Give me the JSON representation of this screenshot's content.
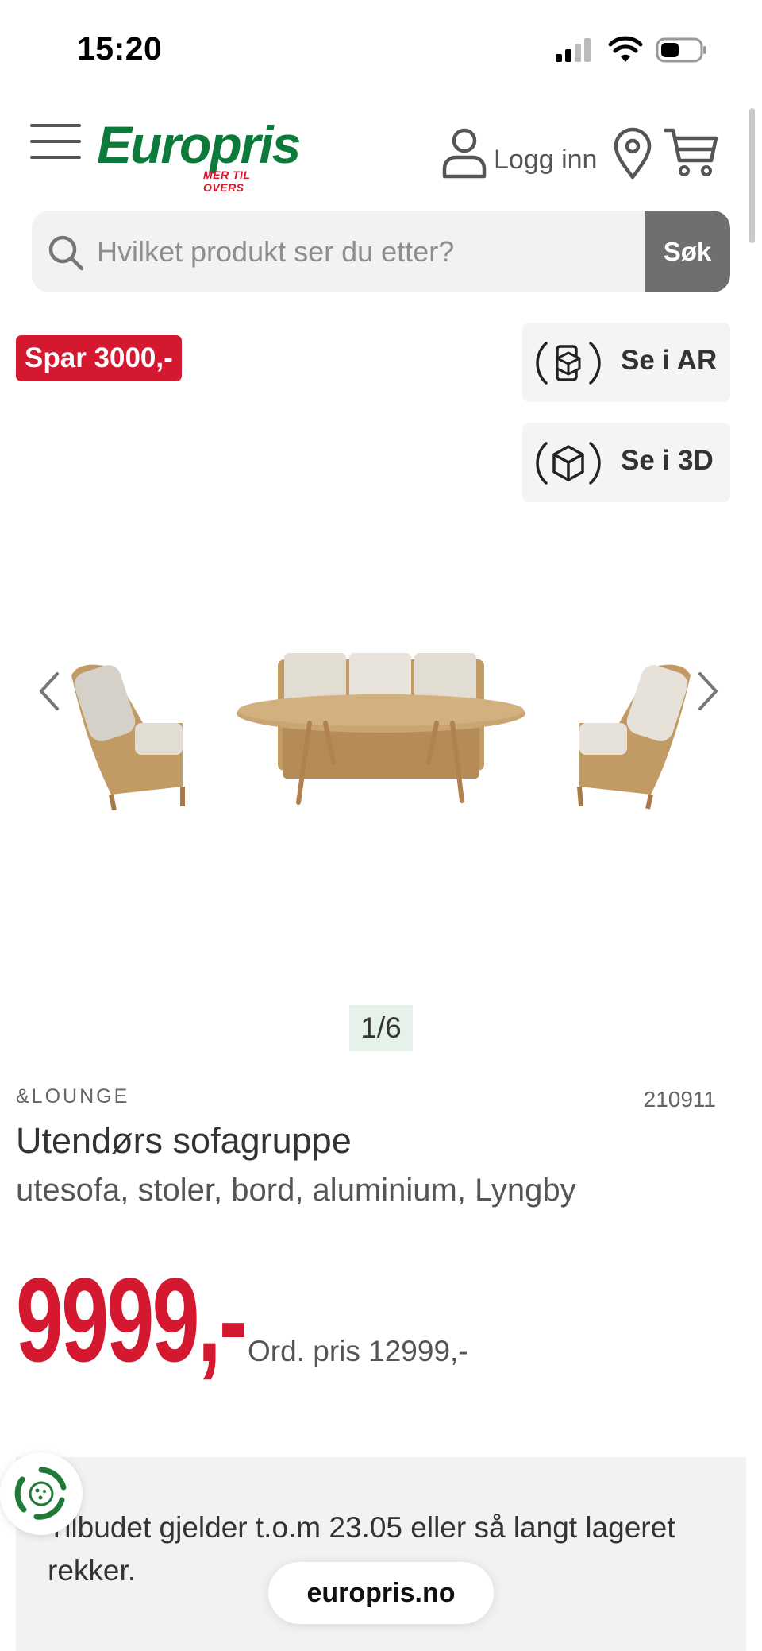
{
  "status_bar": {
    "time": "15:20"
  },
  "header": {
    "logo_text": "Europris",
    "logo_tagline": "MER TIL OVERS",
    "login_label": "Logg inn",
    "brand_color": "#0b7a3a",
    "accent_color": "#d4182f"
  },
  "search": {
    "placeholder": "Hvilket produkt ser du etter?",
    "button_label": "Søk"
  },
  "product": {
    "save_badge": "Spar 3000,-",
    "ar_label": "Se i AR",
    "view3d_label": "Se i 3D",
    "image_counter": "1/6",
    "brand": "&LOUNGE",
    "sku": "210911",
    "title": "Utendørs sofagruppe",
    "subtitle": "utesofa, stoler, bord, aluminium, Lyngby",
    "price": "9999,-",
    "ordinary_price": "Ord. pris 12999,-"
  },
  "notice": {
    "text": "Tilbudet gjelder t.o.m 23.05 eller så langt lageret rekker."
  },
  "browser": {
    "url": "europris.no"
  },
  "icons": [
    "menu-icon",
    "user-icon",
    "location-pin-icon",
    "cart-icon",
    "search-icon",
    "ar-icon",
    "3d-cube-icon",
    "chevron-left-icon",
    "chevron-right-icon",
    "eco-icon"
  ]
}
